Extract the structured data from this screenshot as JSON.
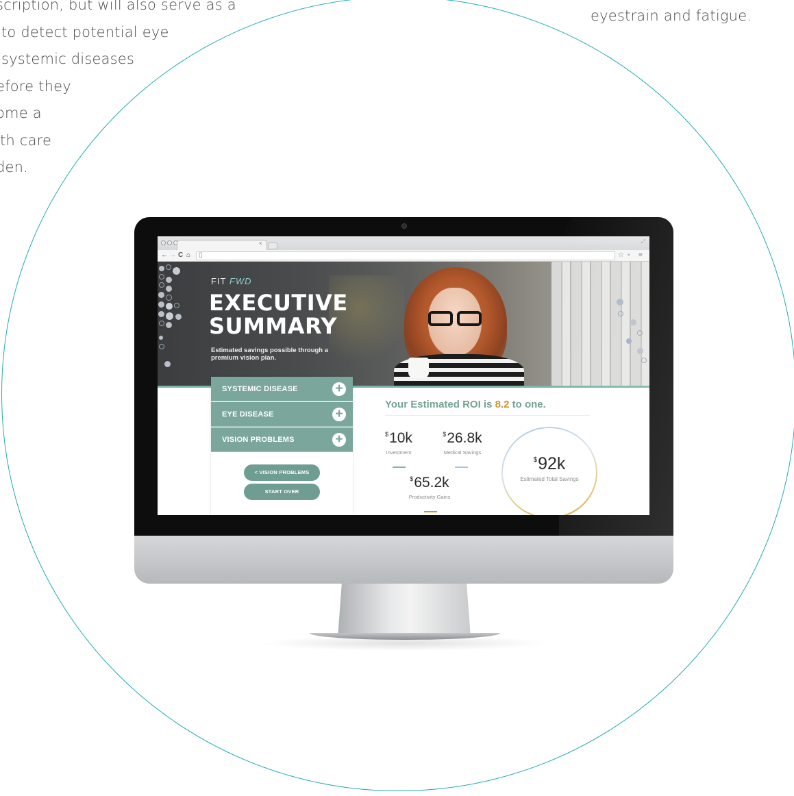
{
  "left_copy": {
    "lines": [
      "scription, but will also serve as a",
      "to detect potential eye",
      "systemic diseases",
      "efore they",
      "ome a",
      "lth care",
      "den."
    ]
  },
  "right_copy": {
    "text": "eyestrain and fatigue."
  },
  "browser": {
    "tab_close": "×",
    "back_glyph": "←",
    "forward_glyph": "→",
    "reload_glyph": "C",
    "home_glyph": "⌂",
    "page_glyph": "▯",
    "star_glyph": "☆",
    "menu_glyph": "≡",
    "expand_glyph": "⤢"
  },
  "hero": {
    "brand_prefix": "FIT ",
    "brand_suffix": "FWD",
    "title_line1": "EXECUTIVE",
    "title_line2": "SUMMARY",
    "subtitle": "Estimated savings possible through a premium vision plan."
  },
  "accordion": [
    {
      "label": "SYSTEMIC DISEASE",
      "icon": "+"
    },
    {
      "label": "EYE DISEASE",
      "icon": "+"
    },
    {
      "label": "VISION PROBLEMS",
      "icon": "+"
    }
  ],
  "buttons": {
    "back": "< VISION PROBLEMS",
    "start_over": "START OVER"
  },
  "roi": {
    "prefix": "Your Estimated ROI is ",
    "value": "8.2",
    "suffix": " to one."
  },
  "stats": {
    "currency": "$",
    "investment": {
      "value": "10k",
      "label": "Investment"
    },
    "medical": {
      "value": "26.8k",
      "label": "Medical Savings"
    },
    "productivity": {
      "value": "65.2k",
      "label": "Productivity Gains"
    },
    "total": {
      "value": "92k",
      "label": "Estimated Total Savings"
    }
  },
  "colors": {
    "circle_outline": "#21a9b4",
    "accordion_teal": "#7ba69b",
    "roi_teal": "#74a295",
    "roi_gold": "#c9962c",
    "investment_bar": "#7fb5a8",
    "medical_bar": "#a9c6e0",
    "productivity_bar": "#c9962c"
  }
}
